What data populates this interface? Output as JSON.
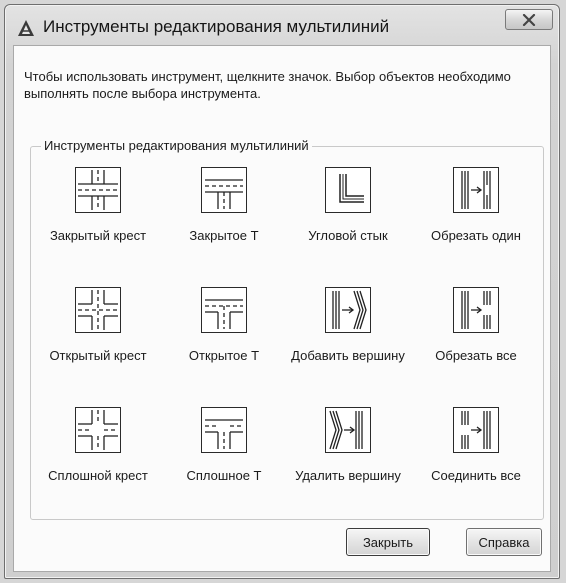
{
  "window": {
    "title": "Инструменты редактирования мультилиний",
    "close_icon": "close-x-icon"
  },
  "instruction": "Чтобы использовать инструмент, щелкните значок. Выбор объектов необходимо выполнять после выбора инструмента.",
  "group": {
    "title": "Инструменты редактирования мультилиний",
    "tools": [
      {
        "icon": "closed-cross-icon",
        "label": "Закрытый крест"
      },
      {
        "icon": "closed-tee-icon",
        "label": "Закрытое Т"
      },
      {
        "icon": "corner-joint-icon",
        "label": "Угловой стык"
      },
      {
        "icon": "cut-single-icon",
        "label": "Обрезать один"
      },
      {
        "icon": "open-cross-icon",
        "label": "Открытый крест"
      },
      {
        "icon": "open-tee-icon",
        "label": "Открытое Т"
      },
      {
        "icon": "add-vertex-icon",
        "label": "Добавить вершину"
      },
      {
        "icon": "cut-all-icon",
        "label": "Обрезать все"
      },
      {
        "icon": "merged-cross-icon",
        "label": "Сплошной крест"
      },
      {
        "icon": "merged-tee-icon",
        "label": "Сплошное Т"
      },
      {
        "icon": "delete-vertex-icon",
        "label": "Удалить вершину"
      },
      {
        "icon": "weld-all-icon",
        "label": "Соединить все"
      }
    ]
  },
  "buttons": {
    "close": "Закрыть",
    "help": "Справка"
  }
}
